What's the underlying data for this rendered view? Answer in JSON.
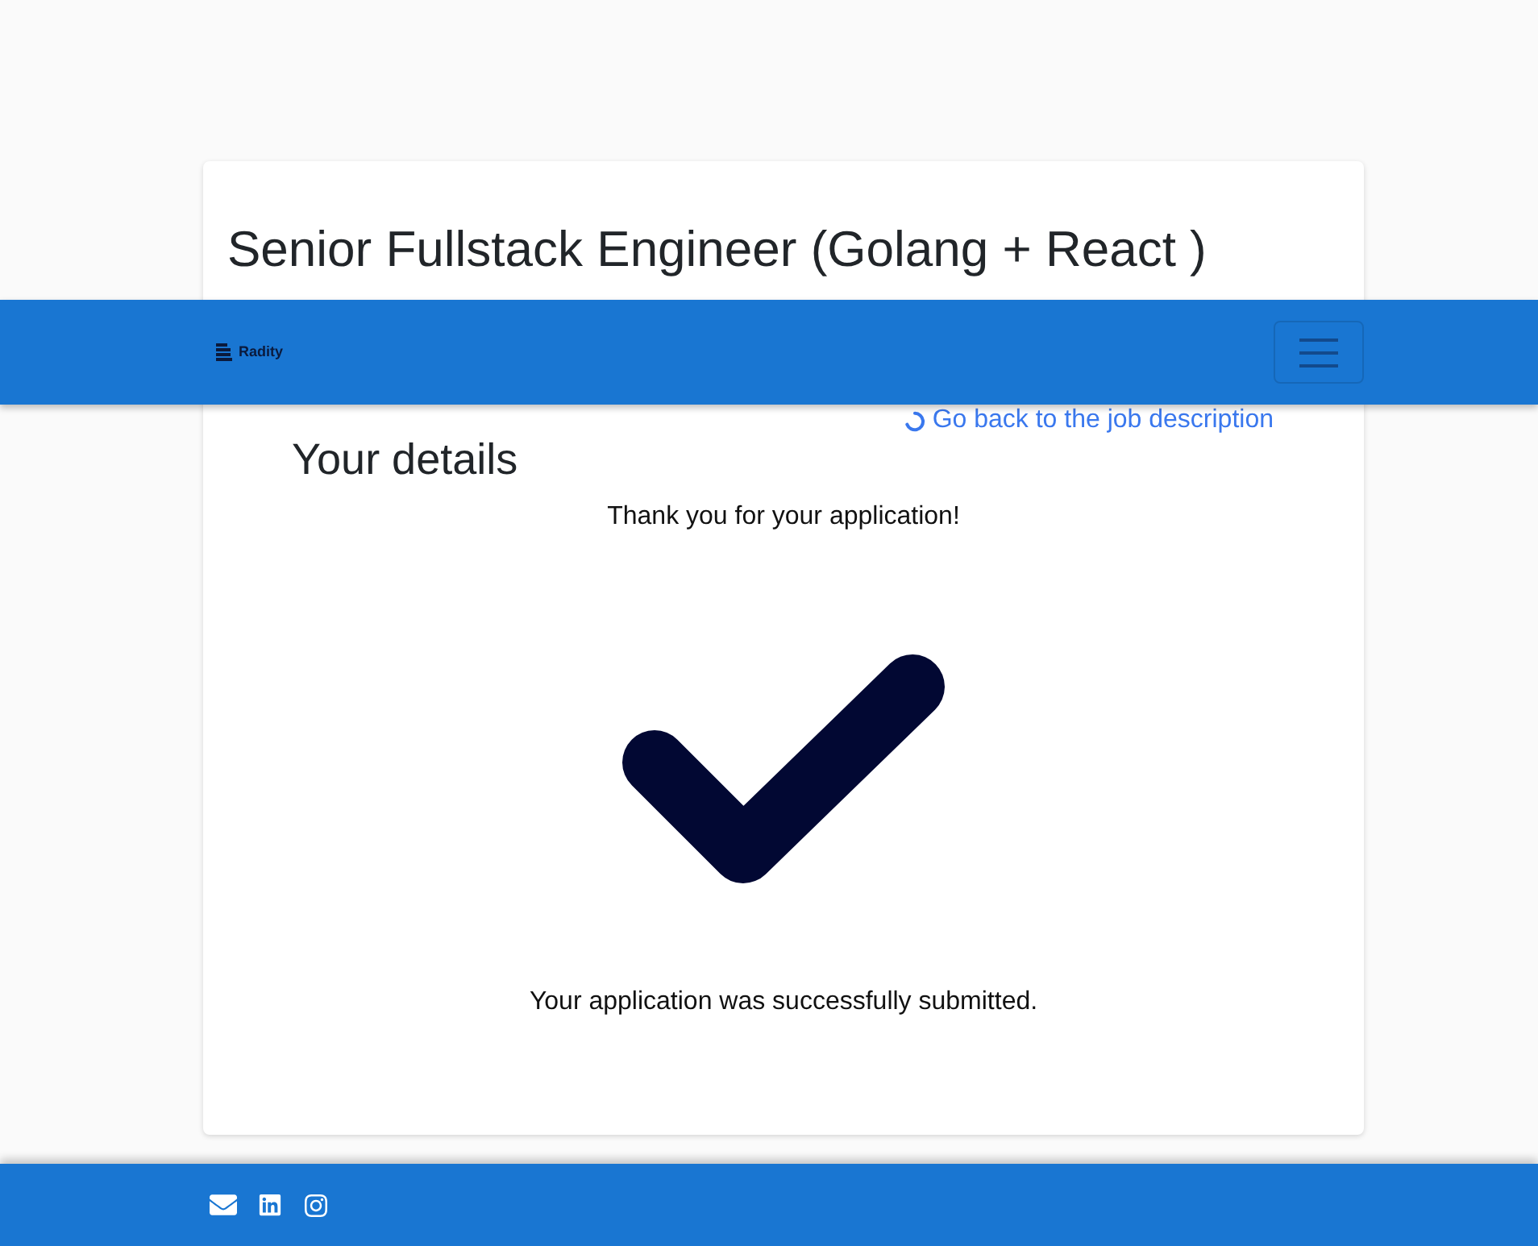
{
  "job": {
    "title": "Senior Fullstack Engineer (Golang + React )"
  },
  "navbar": {
    "logo_text": "Radity"
  },
  "back_link": {
    "label": "Go back to the job description"
  },
  "details": {
    "title": "Your details",
    "message": "Thank you for your application!",
    "confirmation": "Your application was successfully submitted."
  }
}
